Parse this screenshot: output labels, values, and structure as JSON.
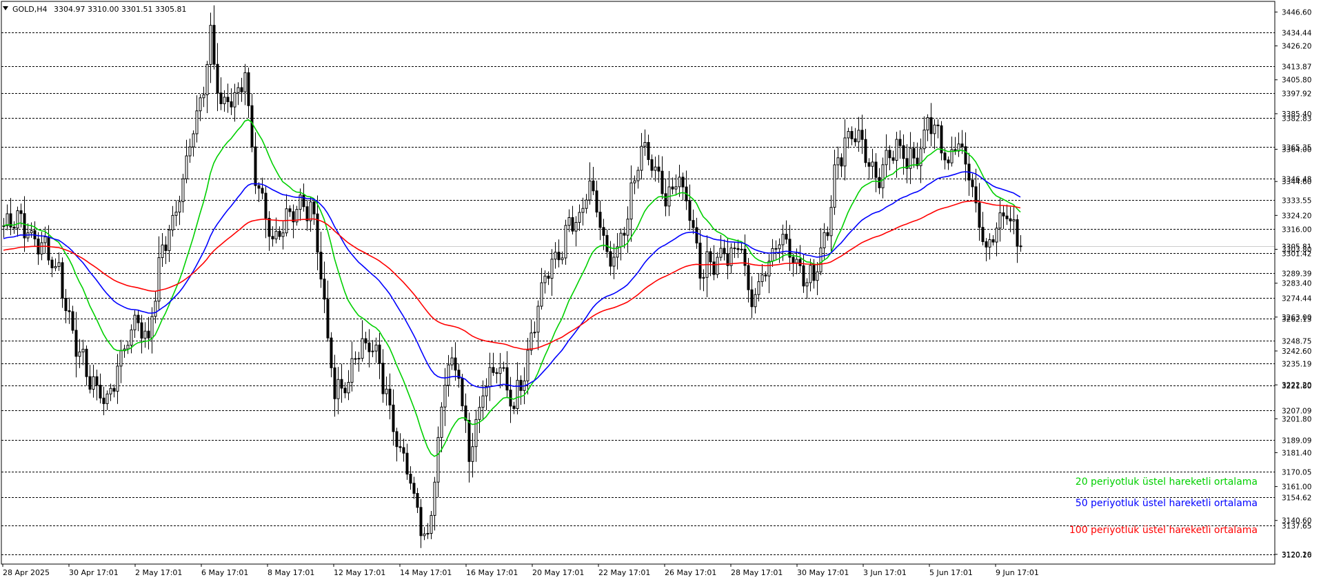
{
  "header": {
    "symbol_label": "GOLD,H4",
    "ohlc_text": "3304.97 3310.00 3301.51 3305.81",
    "menu_icon": "triangle-down-icon"
  },
  "colors": {
    "ema20": "#00d000",
    "ema50": "#0000ff",
    "ema100": "#ff0000",
    "candle": "#000000",
    "grid": "#000000",
    "background": "#ffffff"
  },
  "chart_data": {
    "type": "candlestick",
    "title": "",
    "xlabel": "",
    "ylabel": "",
    "ylim": [
      3114.35,
      3453.0
    ],
    "grid": false,
    "current_price": 3305.81,
    "price_ticks": [
      "3446.60",
      "3426.20",
      "3405.80",
      "3385.40",
      "3364.00",
      "3344.60",
      "3324.20",
      "3303.80",
      "3283.40",
      "3263.00",
      "3242.60",
      "3222.20",
      "3201.80",
      "3181.40",
      "3161.00",
      "3140.60",
      "3120.20"
    ],
    "level_lines": [
      {
        "price": 3434.44,
        "label": "3434.44"
      },
      {
        "price": 3413.87,
        "label": "3413.87"
      },
      {
        "price": 3397.92,
        "label": "3397.92"
      },
      {
        "price": 3382.83,
        "label": "3382.83"
      },
      {
        "price": 3365.35,
        "label": "3365.35"
      },
      {
        "price": 3346.48,
        "label": "3346.48"
      },
      {
        "price": 3333.55,
        "label": "3333.55"
      },
      {
        "price": 3316.0,
        "label": "3316.00"
      },
      {
        "price": 3305.81,
        "label": "3305.81"
      },
      {
        "price": 3301.42,
        "label": "3301.42"
      },
      {
        "price": 3289.39,
        "label": "3289.39"
      },
      {
        "price": 3274.44,
        "label": "3274.44"
      },
      {
        "price": 3262.13,
        "label": "3262.13"
      },
      {
        "price": 3248.75,
        "label": "3248.75"
      },
      {
        "price": 3235.19,
        "label": "3235.19"
      },
      {
        "price": 3221.8,
        "label": "3221.80"
      },
      {
        "price": 3207.09,
        "label": "3207.09"
      },
      {
        "price": 3189.09,
        "label": "3189.09"
      },
      {
        "price": 3170.05,
        "label": "3170.05"
      },
      {
        "price": 3154.62,
        "label": "3154.62"
      },
      {
        "price": 3137.65,
        "label": "3137.65"
      },
      {
        "price": 3120.16,
        "label": "3120.16"
      }
    ],
    "time_labels": [
      "28 Apr 2025",
      "30 Apr 17:01",
      "2 May 17:01",
      "6 May 17:01",
      "8 May 17:01",
      "12 May 17:01",
      "14 May 17:01",
      "16 May 17:01",
      "20 May 17:01",
      "22 May 17:01",
      "26 May 17:01",
      "28 May 17:01",
      "30 May 17:01",
      "3 Jun 17:01",
      "5 Jun 17:01",
      "9 Jun 17:01"
    ],
    "anchors": [
      {
        "i": 0,
        "p": 3318
      },
      {
        "i": 4,
        "p": 3325
      },
      {
        "i": 8,
        "p": 3310
      },
      {
        "i": 12,
        "p": 3305
      },
      {
        "i": 16,
        "p": 3290
      },
      {
        "i": 18,
        "p": 3270
      },
      {
        "i": 22,
        "p": 3240
      },
      {
        "i": 25,
        "p": 3225
      },
      {
        "i": 30,
        "p": 3212
      },
      {
        "i": 35,
        "p": 3245
      },
      {
        "i": 38,
        "p": 3262
      },
      {
        "i": 42,
        "p": 3250
      },
      {
        "i": 46,
        "p": 3305
      },
      {
        "i": 50,
        "p": 3325
      },
      {
        "i": 55,
        "p": 3380
      },
      {
        "i": 58,
        "p": 3400
      },
      {
        "i": 60,
        "p": 3430
      },
      {
        "i": 63,
        "p": 3390
      },
      {
        "i": 67,
        "p": 3395
      },
      {
        "i": 70,
        "p": 3410
      },
      {
        "i": 73,
        "p": 3345
      },
      {
        "i": 78,
        "p": 3305
      },
      {
        "i": 82,
        "p": 3325
      },
      {
        "i": 86,
        "p": 3330
      },
      {
        "i": 90,
        "p": 3325
      },
      {
        "i": 93,
        "p": 3270
      },
      {
        "i": 96,
        "p": 3215
      },
      {
        "i": 100,
        "p": 3225
      },
      {
        "i": 104,
        "p": 3250
      },
      {
        "i": 108,
        "p": 3240
      },
      {
        "i": 113,
        "p": 3200
      },
      {
        "i": 117,
        "p": 3170
      },
      {
        "i": 121,
        "p": 3140
      },
      {
        "i": 123,
        "p": 3128
      },
      {
        "i": 126,
        "p": 3190
      },
      {
        "i": 129,
        "p": 3240
      },
      {
        "i": 132,
        "p": 3230
      },
      {
        "i": 135,
        "p": 3180
      },
      {
        "i": 137,
        "p": 3200
      },
      {
        "i": 140,
        "p": 3225
      },
      {
        "i": 144,
        "p": 3232
      },
      {
        "i": 148,
        "p": 3210
      },
      {
        "i": 151,
        "p": 3232
      },
      {
        "i": 154,
        "p": 3262
      },
      {
        "i": 157,
        "p": 3288
      },
      {
        "i": 161,
        "p": 3300
      },
      {
        "i": 164,
        "p": 3318
      },
      {
        "i": 167,
        "p": 3320
      },
      {
        "i": 170,
        "p": 3342
      },
      {
        "i": 173,
        "p": 3320
      },
      {
        "i": 175,
        "p": 3295
      },
      {
        "i": 178,
        "p": 3300
      },
      {
        "i": 182,
        "p": 3335
      },
      {
        "i": 185,
        "p": 3365
      },
      {
        "i": 188,
        "p": 3355
      },
      {
        "i": 192,
        "p": 3335
      },
      {
        "i": 196,
        "p": 3345
      },
      {
        "i": 199,
        "p": 3328
      },
      {
        "i": 202,
        "p": 3292
      },
      {
        "i": 205,
        "p": 3295
      },
      {
        "i": 208,
        "p": 3302
      },
      {
        "i": 211,
        "p": 3300
      },
      {
        "i": 214,
        "p": 3306
      },
      {
        "i": 216,
        "p": 3275
      },
      {
        "i": 219,
        "p": 3280
      },
      {
        "i": 222,
        "p": 3298
      },
      {
        "i": 225,
        "p": 3312
      },
      {
        "i": 228,
        "p": 3305
      },
      {
        "i": 231,
        "p": 3292
      },
      {
        "i": 233,
        "p": 3282
      },
      {
        "i": 236,
        "p": 3295
      },
      {
        "i": 239,
        "p": 3320
      },
      {
        "i": 241,
        "p": 3348
      },
      {
        "i": 244,
        "p": 3370
      },
      {
        "i": 247,
        "p": 3375
      },
      {
        "i": 250,
        "p": 3362
      },
      {
        "i": 253,
        "p": 3342
      },
      {
        "i": 256,
        "p": 3356
      },
      {
        "i": 259,
        "p": 3370
      },
      {
        "i": 262,
        "p": 3355
      },
      {
        "i": 265,
        "p": 3360
      },
      {
        "i": 268,
        "p": 3380
      },
      {
        "i": 271,
        "p": 3372
      },
      {
        "i": 274,
        "p": 3355
      },
      {
        "i": 277,
        "p": 3368
      },
      {
        "i": 280,
        "p": 3350
      },
      {
        "i": 283,
        "p": 3320
      },
      {
        "i": 285,
        "p": 3300
      },
      {
        "i": 288,
        "p": 3318
      },
      {
        "i": 291,
        "p": 3330
      },
      {
        "i": 294,
        "p": 3305
      }
    ],
    "series": [
      {
        "name": "20 periyotluk üstel hareketli ortalama",
        "color": "#00d000",
        "period": 20
      },
      {
        "name": "50 periyotluk üstel hareketli ortalama",
        "color": "#0000ff",
        "period": 50
      },
      {
        "name": "100 periyotluk üstel hareketli ortalama",
        "color": "#ff0000",
        "period": 100
      }
    ],
    "legend_position": "bottom-right"
  },
  "legend": {
    "ema20": "20 periyotluk üstel hareketli ortalama",
    "ema50": "50 periyotluk üstel hareketli ortalama",
    "ema100": "100 periyotluk üstel hareketli ortalama"
  }
}
